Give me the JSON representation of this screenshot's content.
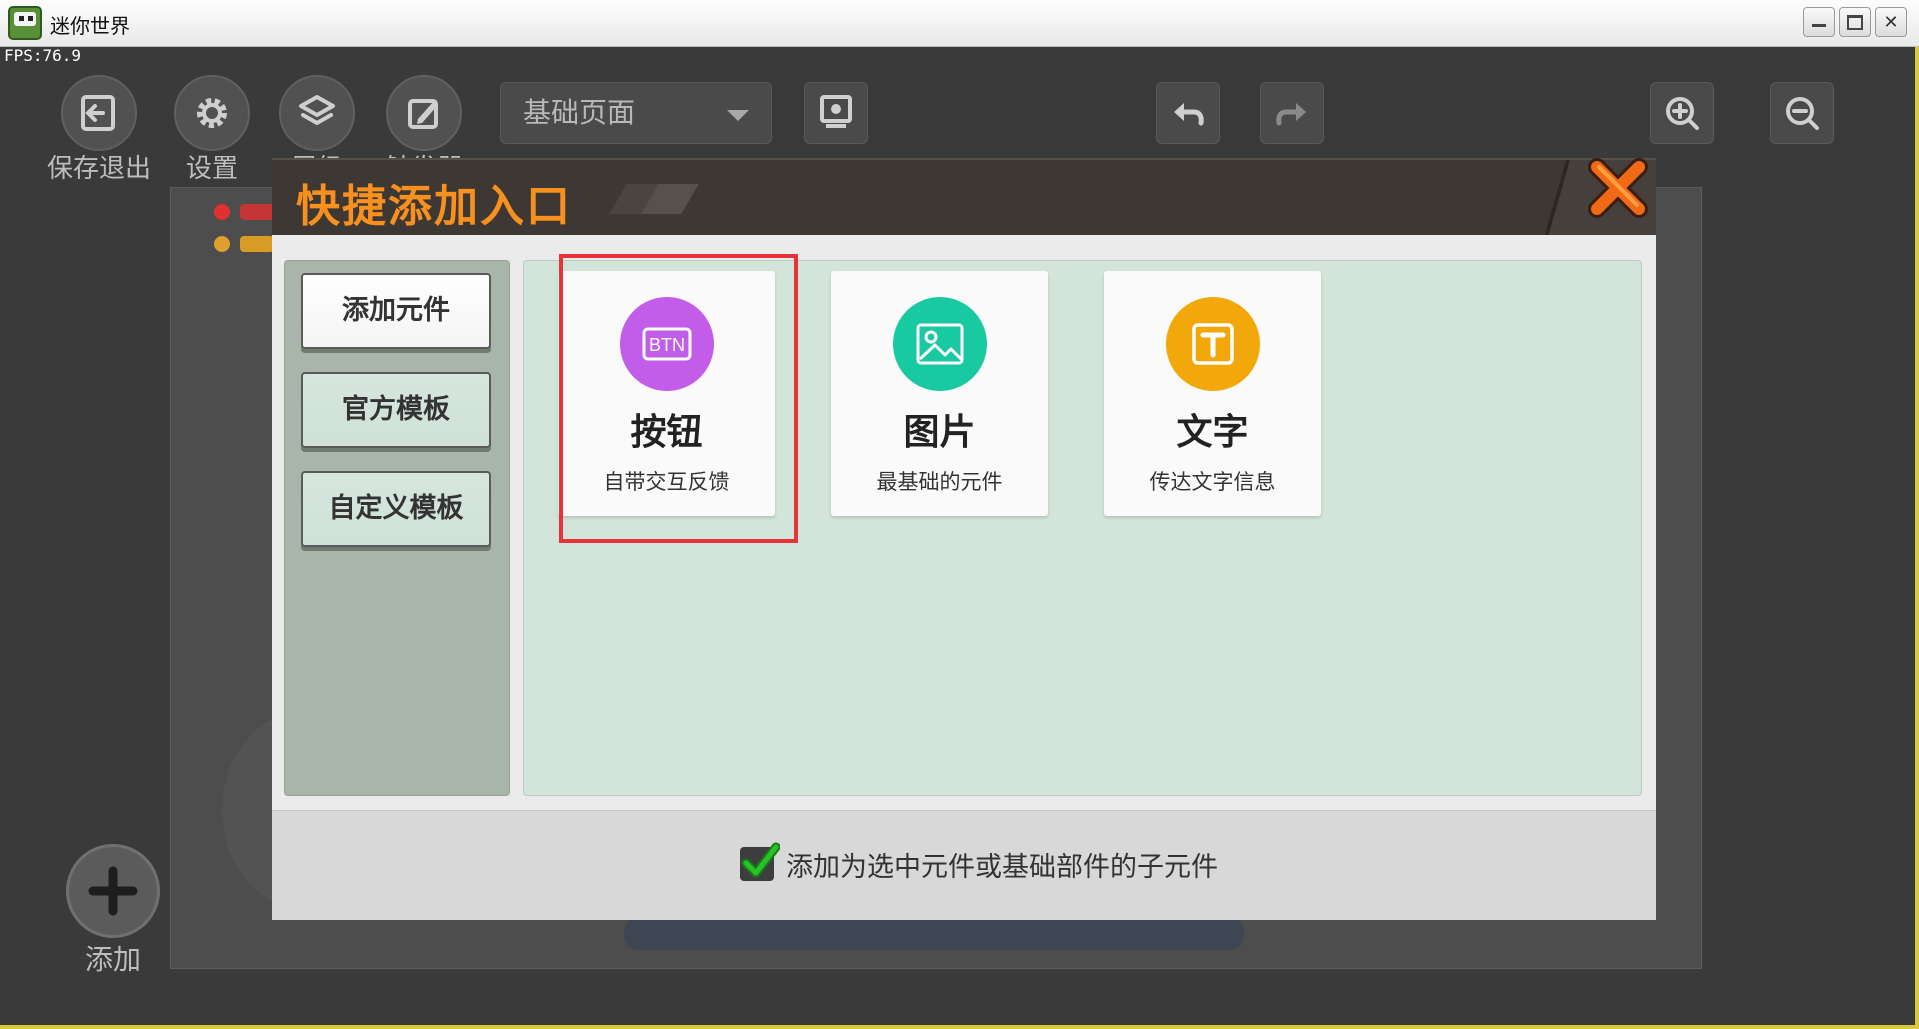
{
  "window": {
    "title": "迷你世界"
  },
  "fps": "FPS:76.9",
  "toolbar": {
    "save_exit": "保存退出",
    "settings": "设置",
    "layers": "层级",
    "trigger": "触发器",
    "page_select": "基础页面"
  },
  "add": {
    "label": "添加"
  },
  "modal": {
    "title": "快捷添加入口",
    "sidebar": [
      {
        "label": "添加元件",
        "selected": true
      },
      {
        "label": "官方模板",
        "selected": false
      },
      {
        "label": "自定义模板",
        "selected": false
      }
    ],
    "cards": [
      {
        "icon": "btn-icon",
        "title": "按钮",
        "subtitle": "自带交互反馈",
        "color": "#c15de8",
        "highlighted": true
      },
      {
        "icon": "image-icon",
        "title": "图片",
        "subtitle": "最基础的元件",
        "color": "#19c9a2",
        "highlighted": false
      },
      {
        "icon": "text-icon",
        "title": "文字",
        "subtitle": "传达文字信息",
        "color": "#f2a70b",
        "highlighted": false
      }
    ],
    "footer": {
      "checkbox_label": "添加为选中元件或基础部件的子元件",
      "checked": true
    }
  },
  "colors": {
    "accent_orange": "#f7901e",
    "highlight_red": "#e9333a",
    "checkbox_green": "#27c227"
  }
}
